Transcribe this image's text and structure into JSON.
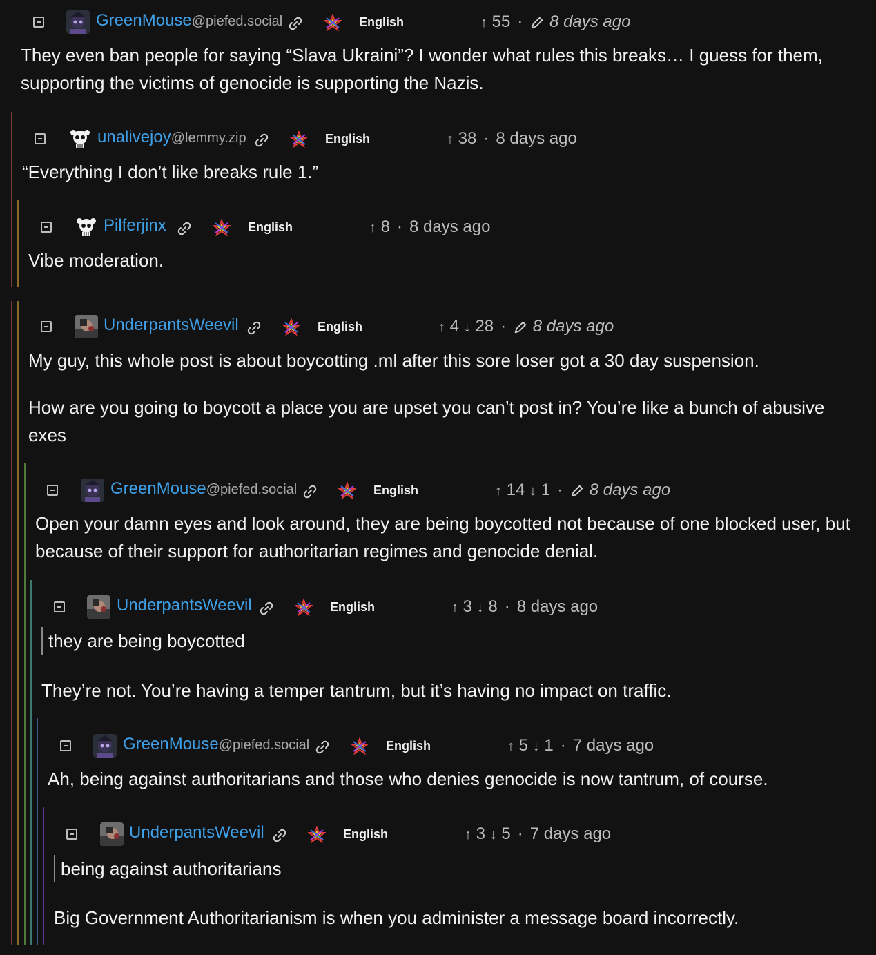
{
  "comments": [
    {
      "user": "GreenMouse",
      "instance": "@piefed.social",
      "language": "English",
      "up": "55",
      "down": "",
      "time": "8 days ago",
      "body": [
        "They even ban people for saying “Slava Ukraini”? I wonder what rules this breaks… I guess for them,",
        "supporting the victims of genocide is supporting the Nazis."
      ]
    },
    {
      "user": "unalivejoy",
      "instance": "@lemmy.zip",
      "language": "English",
      "up": "38",
      "down": "",
      "time": "8 days ago",
      "body": [
        "“Everything I don’t like breaks rule 1.”"
      ]
    },
    {
      "user": "Pilferjinx",
      "instance": "",
      "language": "English",
      "up": "8",
      "down": "",
      "time": "8 days ago",
      "body": [
        "Vibe moderation."
      ]
    },
    {
      "user": "UnderpantsWeevil",
      "instance": "",
      "language": "English",
      "up": "4",
      "down": "28",
      "time": "8 days ago",
      "body": [
        "My guy, this whole post is about boycotting .ml after this sore loser got a 30 day suspension.",
        "How are you going to boycott a place you are upset you can’t post in? You’re like a bunch of abusive",
        "exes"
      ]
    },
    {
      "user": "GreenMouse",
      "instance": "@piefed.social",
      "language": "English",
      "up": "14",
      "down": "1",
      "time": "8 days ago",
      "body": [
        "Open your damn eyes and look around, they are being boycotted not because of one blocked user, but",
        "because of their support for authoritarian regimes and genocide denial."
      ]
    },
    {
      "user": "UnderpantsWeevil",
      "instance": "",
      "language": "English",
      "up": "3",
      "down": "8",
      "time": "8 days ago",
      "quote": "they are being boycotted",
      "body": [
        "They’re not. You’re having a temper tantrum, but it’s having no impact on traffic."
      ]
    },
    {
      "user": "GreenMouse",
      "instance": "@piefed.social",
      "language": "English",
      "up": "5",
      "down": "1",
      "time": "7 days ago",
      "body": [
        "Ah, being against authoritarians and those who denies genocide is now tantrum, of course."
      ]
    },
    {
      "user": "UnderpantsWeevil",
      "instance": "",
      "language": "English",
      "up": "3",
      "down": "5",
      "time": "7 days ago",
      "quote": "being against authoritarians",
      "body": [
        "Big Government Authoritarianism is when you administer a message board incorrectly."
      ]
    }
  ],
  "colors": {
    "username": "#3f9fe6",
    "thread_line_1": "#7a3b30",
    "thread_line_2": "#8a6a2a",
    "thread_line_3": "#4f7a3a",
    "thread_line_4": "#3a7a6a",
    "thread_line_5": "#3a5a8a",
    "thread_line_6": "#5a3a8a"
  }
}
